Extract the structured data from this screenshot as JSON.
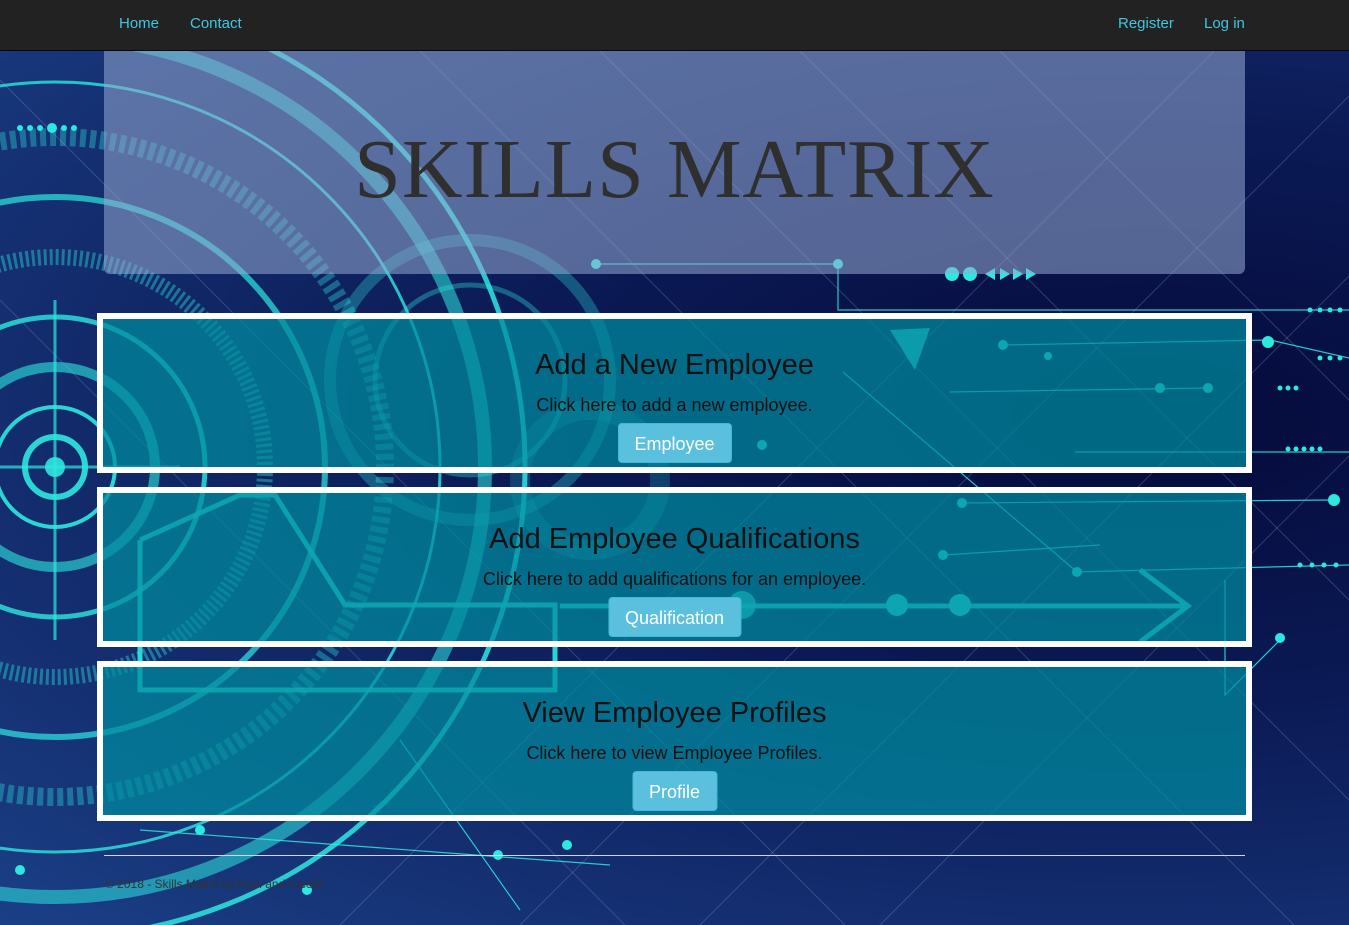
{
  "nav": {
    "left_links": [
      "Home",
      "Contact"
    ],
    "right_links": [
      "Register",
      "Log in"
    ]
  },
  "jumbotron": {
    "title": "SKILLS MATRIX"
  },
  "panels": [
    {
      "heading": "Add a New Employee",
      "description": "Click here to add a new employee.",
      "button": "Employee"
    },
    {
      "heading": "Add Employee Qualifications",
      "description": "Click here to add qualifications for an employee.",
      "button": "Qualification"
    },
    {
      "heading": "View Employee Profiles",
      "description": "Click here to view Employee Profiles.",
      "button": "Profile"
    }
  ],
  "footer": {
    "text": "© 2018 - Skills Matrix by Kian and Cicelie"
  },
  "colors": {
    "navbar": "#222222",
    "nav_link": "#3fc6e2",
    "button": "#5bc0de",
    "panel_border": "#ffffff",
    "accent_cyan": "#2de8e0"
  },
  "icons": {
    "background": "circuit-background-image"
  }
}
